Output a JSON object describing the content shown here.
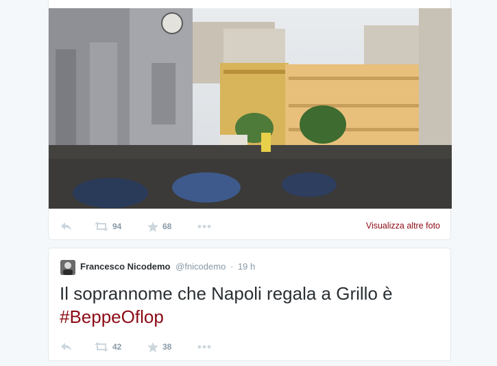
{
  "tweet1": {
    "retweets": "94",
    "favorites": "68",
    "more_photos_label": "Visualizza altre foto"
  },
  "tweet2": {
    "fullname": "Francesco Nicodemo",
    "handle": "@fnicodemo",
    "separator": "·",
    "time": "19 h",
    "text": "Il soprannome che Napoli regala a Grillo è",
    "hashtag": "#BeppeOflop",
    "retweets": "42",
    "favorites": "38"
  },
  "icons": {
    "reply": "reply-arrow-icon",
    "retweet": "retweet-icon",
    "favorite": "star-icon",
    "more": "ellipsis-icon"
  },
  "colors": {
    "link": "#8b0a14",
    "icon": "#ccd6dd",
    "count": "#8899a6",
    "text": "#292f33"
  }
}
